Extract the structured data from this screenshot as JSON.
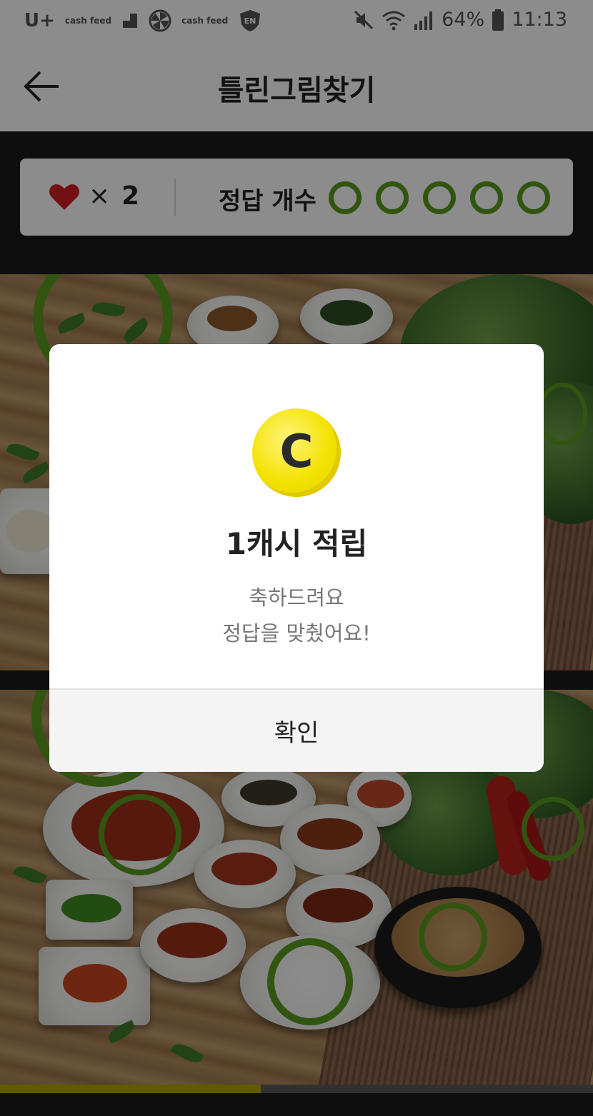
{
  "status_bar": {
    "carrier": "U+",
    "app_badges": [
      "cash feed",
      "cash feed"
    ],
    "en_badge": "EN",
    "battery": "64%",
    "time": "11:13",
    "icons": [
      "mute-icon",
      "wifi-icon",
      "signal-icon",
      "battery-icon"
    ]
  },
  "header": {
    "title": "틀린그림찾기",
    "back_icon": "arrow-left-icon"
  },
  "score": {
    "lives_multiplier": "×",
    "lives": "2",
    "answer_label": "정답 개수",
    "answers_total": 5,
    "answers_found": 0,
    "accent_color": "#5a9b1e"
  },
  "progress": {
    "fraction": 0.44,
    "fill_color": "#b3a200"
  },
  "dialog": {
    "coin_letter": "C",
    "title": "1캐시 적립",
    "message_line1": "축하드려요",
    "message_line2": "정답을 맞췄어요!",
    "confirm_label": "확인"
  }
}
